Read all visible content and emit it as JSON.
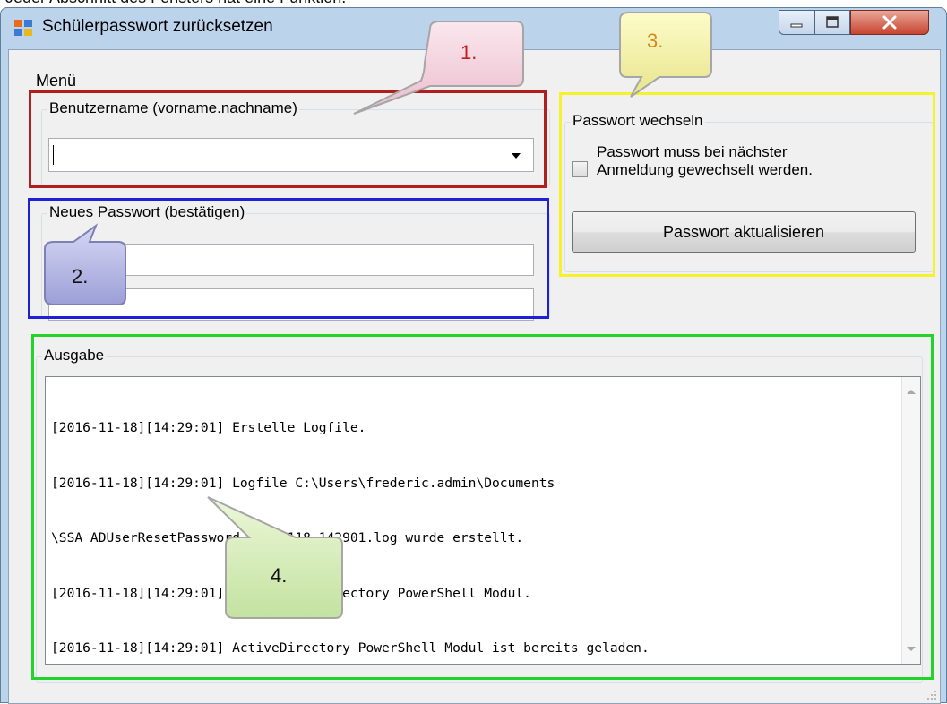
{
  "caption": "Jeder Abschnitt des Fensters hat eine Funktion.",
  "window": {
    "title": "Schülerpasswort zurücksetzen",
    "menu": "Menü"
  },
  "username": {
    "group_title": "Benutzername (vorname.nachname)",
    "value": ""
  },
  "new_password": {
    "group_title": "Neues Passwort (bestätigen)",
    "password_value": "",
    "confirm_value": ""
  },
  "change_password": {
    "group_title": "Passwort wechseln",
    "checkbox_label_line1": "Passwort muss bei nächster",
    "checkbox_label_line2": "Anmeldung gewechselt werden.",
    "checkbox_checked": false,
    "update_button": "Passwort aktualisieren"
  },
  "output": {
    "group_title": "Ausgabe",
    "log_lines": [
      "[2016-11-18][14:29:01] Erstelle Logfile.",
      "[2016-11-18][14:29:01] Logfile C:\\Users\\frederic.admin\\Documents",
      "\\SSA_ADUserResetPassword_20161118_142901.log wurde erstellt.",
      "[2016-11-18][14:29:01] Lade ActiveDirectory PowerShell Modul.",
      "[2016-11-18][14:29:01] ActiveDirectory PowerShell Modul ist bereits geladen."
    ]
  },
  "callouts": {
    "one": "1.",
    "two": "2.",
    "three": "3.",
    "four": "4."
  },
  "colors": {
    "frame_red": "#b01e1e",
    "frame_blue": "#1f1fd6",
    "frame_yellow": "#f4f22c",
    "frame_green": "#22d42a"
  }
}
